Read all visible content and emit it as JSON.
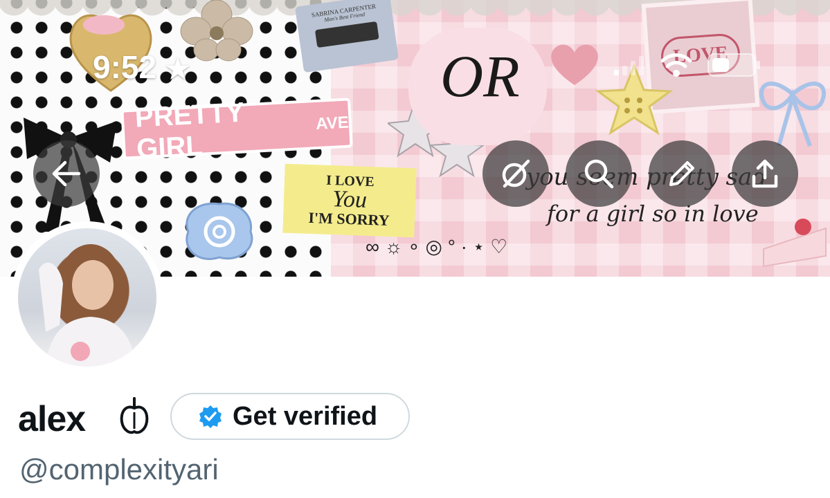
{
  "status_bar": {
    "time": "9:52"
  },
  "banner": {
    "street_sign": "PRETTY GIRL",
    "street_sign_suffix": "AVE",
    "stamp_text": "LOVE",
    "monogram": "OR",
    "lyric_line_1": "you seem pretty sad",
    "lyric_line_2": "for a girl so in love",
    "sticker_line_1": "I LOVE",
    "sticker_line_2": "You",
    "sticker_line_3": "I'M SORRY",
    "cassette_title": "SABRINA CARPENTER",
    "cassette_subtitle": "Man's Best Friend"
  },
  "profile": {
    "display_name": "alex",
    "handle": "@complexityari",
    "verify_button_label": "Get verified"
  },
  "colors": {
    "verified_blue": "#1d9bf0",
    "handle_gray": "#536471",
    "name_black": "#0f1419"
  },
  "icons": [
    "back-arrow-icon",
    "grok-icon",
    "search-icon",
    "edit-pencil-icon",
    "share-icon",
    "verified-badge-icon",
    "apple-emoji-icon",
    "star-icon",
    "wifi-icon",
    "battery-icon",
    "signal-icon"
  ]
}
